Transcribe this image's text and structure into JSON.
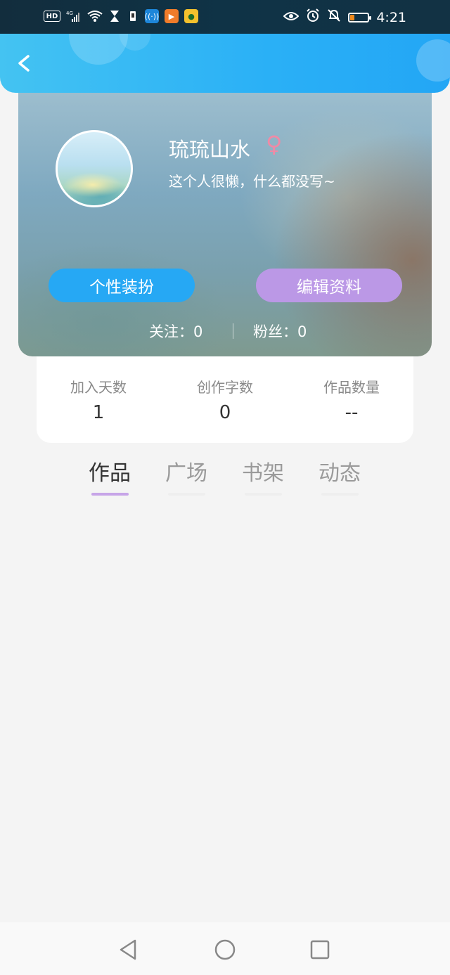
{
  "status_bar": {
    "left_icons": [
      "hd-icon",
      "signal-4g-icon",
      "wifi-icon",
      "hourglass-icon",
      "sim-icon",
      "app-wifi-icon",
      "app-video-icon",
      "app-fruit-icon"
    ],
    "network_label": "HD",
    "network_type": "4G",
    "right_icons": [
      "eye-icon",
      "alarm-icon",
      "mute-bell-icon",
      "battery-icon"
    ],
    "time": "4:21"
  },
  "header": {
    "back_icon": "chevron-left-icon",
    "colors": {
      "start": "#44c3f2",
      "end": "#23a6f5"
    }
  },
  "profile": {
    "username": "琉琉山水",
    "gender_symbol": "♀",
    "bio": "这个人很懒，什么都没写~",
    "dress_button": "个性装扮",
    "edit_button": "编辑资料",
    "follow_label": "关注：0",
    "fans_label": "粉丝：0",
    "colors": {
      "dress": "#26a8f4",
      "edit": "#bb98e6",
      "gender": "#f08aa6"
    }
  },
  "stats": [
    {
      "label": "加入天数",
      "value": "1"
    },
    {
      "label": "创作字数",
      "value": "0"
    },
    {
      "label": "作品数量",
      "value": "--"
    }
  ],
  "tabs": [
    {
      "label": "作品",
      "active": true
    },
    {
      "label": "广场",
      "active": false
    },
    {
      "label": "书架",
      "active": false
    },
    {
      "label": "动态",
      "active": false
    }
  ],
  "nav_bar": {
    "buttons": [
      "back-triangle-icon",
      "home-circle-icon",
      "recents-square-icon"
    ]
  }
}
